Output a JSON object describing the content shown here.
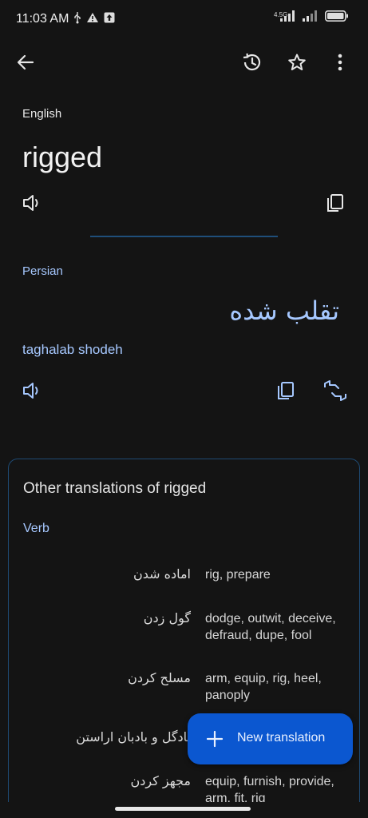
{
  "status_bar": {
    "time": "11:03 AM",
    "network_label": "4.5G"
  },
  "app_bar": {
    "back_icon": "arrow-left-icon",
    "history_icon": "history-icon",
    "favorite_icon": "star-icon",
    "menu_icon": "more-vert-icon"
  },
  "source": {
    "language": "English",
    "text": "rigged"
  },
  "target": {
    "language": "Persian",
    "text": "تقلب شده",
    "transliteration": "taghalab shodeh"
  },
  "other_translations": {
    "title": "Other translations of rigged",
    "part_of_speech": "Verb",
    "rows": [
      {
        "persian": "اماده شدن",
        "english": "rig, prepare"
      },
      {
        "persian": "گول زدن",
        "english": "dodge, outwit, deceive, defraud, dupe, fool"
      },
      {
        "persian": "مسلح کردن",
        "english": "arm, equip, rig, heel, panoply"
      },
      {
        "persian": "بادگل و بادبان اراستن",
        "english": ""
      },
      {
        "persian": "مجهز کردن",
        "english": "equip, furnish, provide, arm, fit, rig"
      }
    ]
  },
  "fab": {
    "label": "New translation"
  },
  "colors": {
    "background": "#141414",
    "accent_blue": "#a6c8ff",
    "fab_blue": "#0b57d0",
    "card_border": "#1e4a73"
  }
}
